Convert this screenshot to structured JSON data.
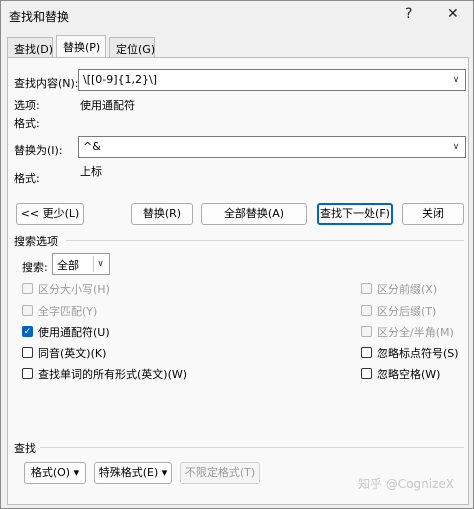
{
  "window": {
    "title": "查找和替换",
    "help": "?",
    "close": "✕"
  },
  "tabs": [
    {
      "label": "查找(D)"
    },
    {
      "label": "替换(P)"
    },
    {
      "label": "定位(G)"
    }
  ],
  "find": {
    "label": "查找内容(N):",
    "value": "\\[[0-9]{1,2}\\]",
    "options_label": "选项:",
    "options_value": "使用通配符",
    "format_label": "格式:"
  },
  "replace": {
    "label": "替换为(I):",
    "value": "^&",
    "format_label": "格式:",
    "format_value": "上标"
  },
  "buttons": {
    "less": "<< 更少(L)",
    "replace": "替换(R)",
    "replace_all": "全部替换(A)",
    "find_next": "查找下一处(F)",
    "close": "关闭"
  },
  "search_options": {
    "heading": "搜索选项",
    "search_label": "搜索:",
    "search_value": "全部",
    "left": [
      {
        "label": "区分大小写(H)",
        "checked": false,
        "disabled": true
      },
      {
        "label": "全字匹配(Y)",
        "checked": false,
        "disabled": true
      },
      {
        "label": "使用通配符(U)",
        "checked": true,
        "disabled": false
      },
      {
        "label": "同音(英文)(K)",
        "checked": false,
        "disabled": false
      },
      {
        "label": "查找单词的所有形式(英文)(W)",
        "checked": false,
        "disabled": false
      }
    ],
    "right": [
      {
        "label": "区分前缀(X)",
        "checked": false,
        "disabled": true
      },
      {
        "label": "区分后缀(T)",
        "checked": false,
        "disabled": true
      },
      {
        "label": "区分全/半角(M)",
        "checked": false,
        "disabled": true
      },
      {
        "label": "忽略标点符号(S)",
        "checked": false,
        "disabled": false
      },
      {
        "label": "忽略空格(W)",
        "checked": false,
        "disabled": false
      }
    ]
  },
  "find_section": {
    "heading": "查找",
    "format_btn": "格式(O) ▾",
    "special_btn": "特殊格式(E) ▾",
    "no_format_btn": "不限定格式(T)"
  },
  "watermark": "知乎 @CognizeX"
}
